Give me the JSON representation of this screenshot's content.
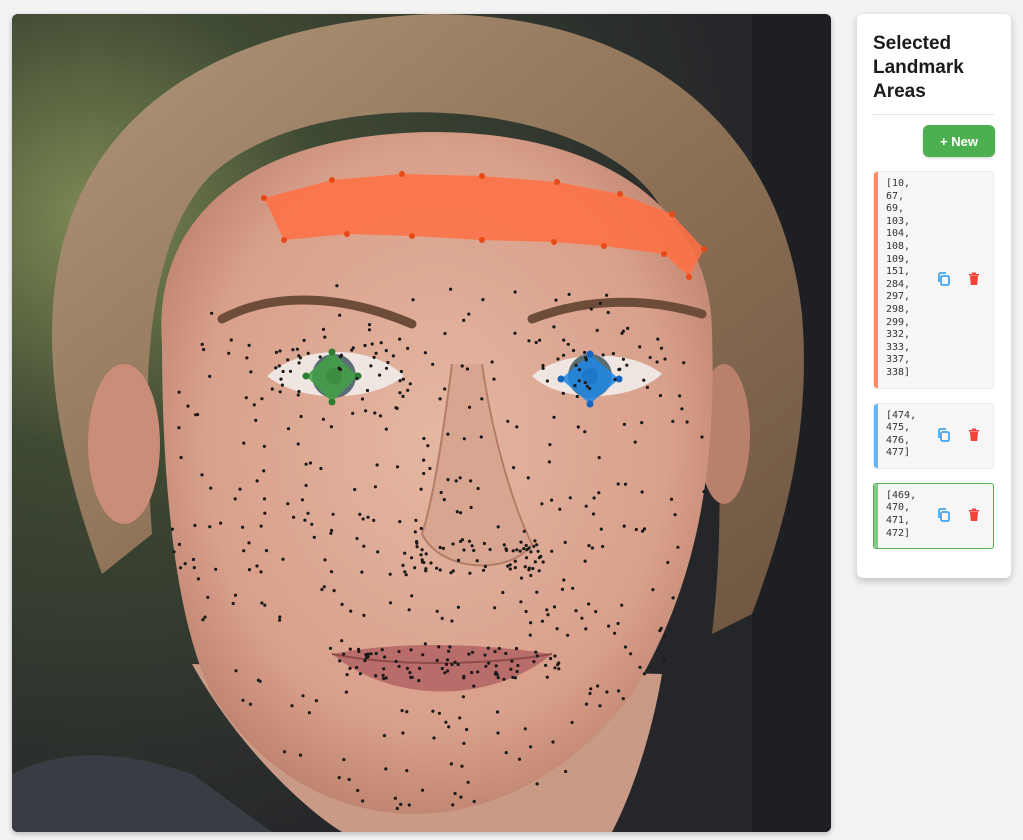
{
  "panel": {
    "title": "Selected Landmark Areas",
    "new_button_label": "+ New"
  },
  "areas": [
    {
      "ids_text": "[10,\n67,\n69,\n103,\n104,\n108,\n109,\n151,\n284,\n297,\n298,\n299,\n332,\n333,\n337,\n338]",
      "color": "#ff8a65",
      "selected": false
    },
    {
      "ids_text": "[474,\n475,\n476,\n477]",
      "color": "#64b5f6",
      "selected": false
    },
    {
      "ids_text": "[469,\n470,\n471,\n472]",
      "color": "#81c784",
      "selected": true
    }
  ],
  "colors": {
    "forehead_region": "#ff7043",
    "right_iris_region": "#1e88e5",
    "left_iris_region": "#43a047",
    "new_button": "#4caf50",
    "copy_icon": "#2196f3",
    "delete_icon": "#f44336"
  },
  "icons": [
    "copy-icon",
    "delete-icon"
  ]
}
